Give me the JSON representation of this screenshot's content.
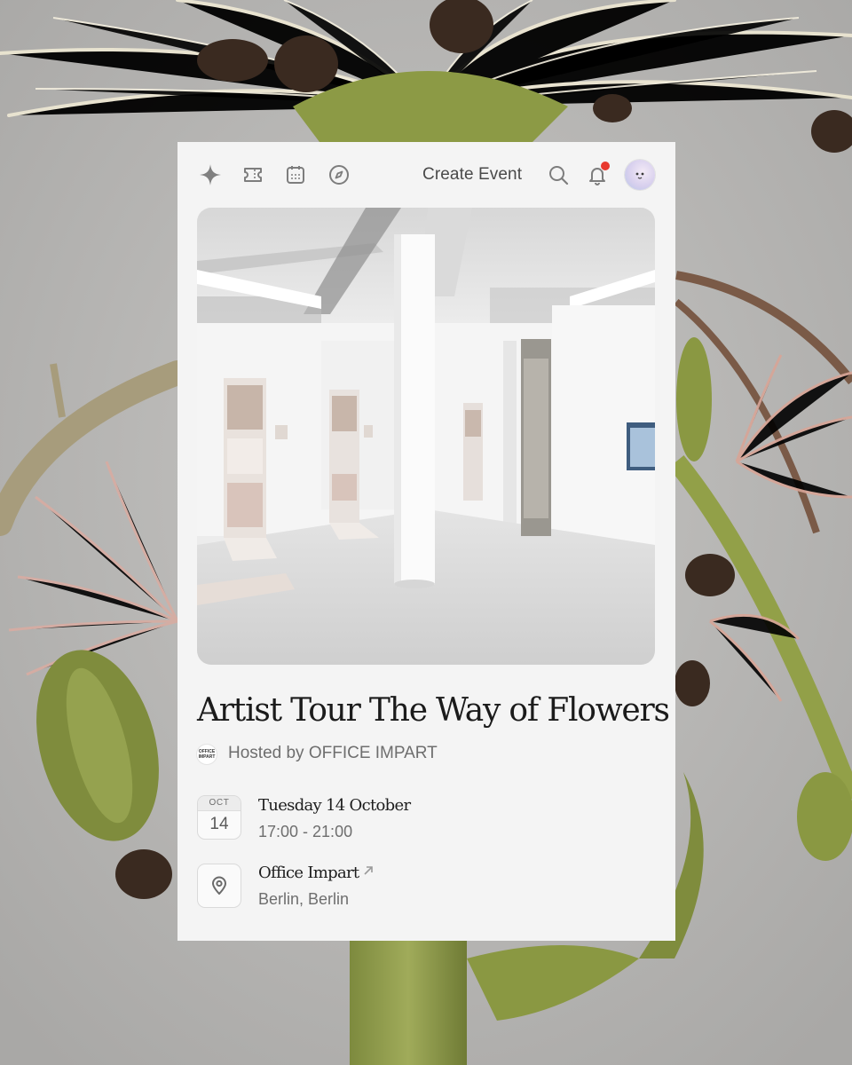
{
  "nav": {
    "icons": [
      "sparkle-icon",
      "ticket-icon",
      "calendar-icon",
      "compass-icon",
      "search-icon",
      "bell-icon"
    ],
    "create_event_label": "Create Event"
  },
  "event": {
    "title": "Artist Tour The Way of Flowers",
    "host_label": "Hosted by OFFICE IMPART",
    "host_logo_text": "OFFICE IMPART",
    "date": {
      "month": "OCT",
      "day": "14",
      "full_date": "Tuesday 14 October",
      "time": "17:00 - 21:00"
    },
    "location": {
      "venue": "Office Impart",
      "city": "Berlin, Berlin"
    }
  },
  "colors": {
    "card_bg": "#f4f4f4",
    "notification_dot": "#e8392e",
    "page_bg": "#b9b8b6"
  }
}
